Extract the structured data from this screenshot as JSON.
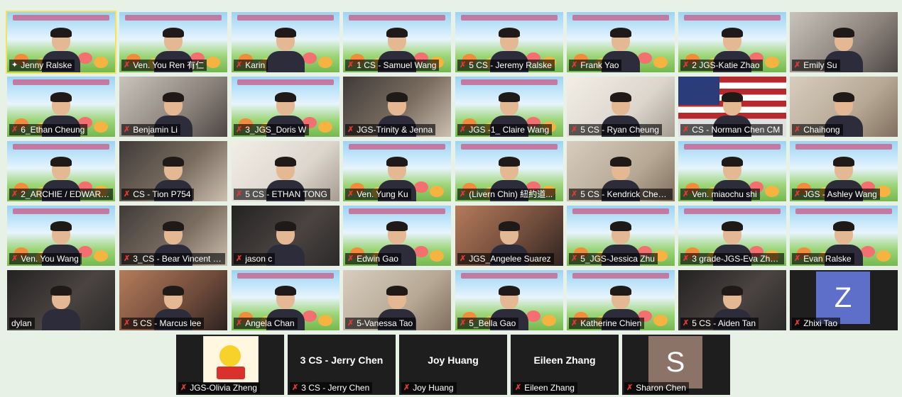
{
  "colors": {
    "active_border": "#f3e35a",
    "muted_mic": "#e53935",
    "avatar_z": "#5d6fc8",
    "avatar_s": "#8b7368"
  },
  "participants": [
    {
      "name": "Jenny Ralske",
      "icon": "pin-icon"
    },
    {
      "name": "Ven. You Ren 有仁",
      "icon": "mic-muted-icon"
    },
    {
      "name": "Karin",
      "icon": "mic-muted-icon"
    },
    {
      "name": "1 CS - Samuel Wang",
      "icon": "mic-muted-icon"
    },
    {
      "name": "5 CS - Jeremy Ralske",
      "icon": "mic-muted-icon"
    },
    {
      "name": "Frank Yao",
      "icon": "mic-muted-icon"
    },
    {
      "name": "2 JGS-Katie Zhao",
      "icon": "mic-muted-icon"
    },
    {
      "name": "Emily Su",
      "icon": "mic-muted-icon"
    },
    {
      "name": "6_Ethan Cheung",
      "icon": "mic-muted-icon"
    },
    {
      "name": "Benjamin Li",
      "icon": "mic-muted-icon"
    },
    {
      "name": "3_JGS_Doris W",
      "icon": "mic-muted-icon"
    },
    {
      "name": "JGS-Trinity & Jenna",
      "icon": "mic-muted-icon"
    },
    {
      "name": "JGS -1_ Claire Wang",
      "icon": "mic-muted-icon"
    },
    {
      "name": "5 CS - Ryan Cheung",
      "icon": "mic-muted-icon"
    },
    {
      "name": "CS - Norman Chen CM",
      "icon": "mic-muted-icon"
    },
    {
      "name": "Chaihong",
      "icon": "mic-muted-icon"
    },
    {
      "name": "2_ARCHIE / EDWARD ...",
      "icon": "mic-muted-icon"
    },
    {
      "name": "CS - Tion P754",
      "icon": "mic-muted-icon"
    },
    {
      "name": "5 CS - ETHAN TONG",
      "icon": "mic-muted-icon"
    },
    {
      "name": "Ven. Yung Ku",
      "icon": "mic-muted-icon"
    },
    {
      "name": "(Livern Chin) 紐約道...",
      "icon": "mic-muted-icon"
    },
    {
      "name": "5 CS - Kendrick Cheu...",
      "icon": "mic-muted-icon"
    },
    {
      "name": "Ven. miaochu shi",
      "icon": "mic-muted-icon"
    },
    {
      "name": "JGS - Ashley Wang",
      "icon": "mic-muted-icon"
    },
    {
      "name": "Ven. You Wang",
      "icon": "mic-muted-icon"
    },
    {
      "name": "3_CS - Bear Vincent H...",
      "icon": "mic-muted-icon"
    },
    {
      "name": "jason c",
      "icon": "mic-muted-icon"
    },
    {
      "name": "Edwin Gao",
      "icon": "mic-muted-icon"
    },
    {
      "name": "JGS_Angelee Suarez",
      "icon": "mic-muted-icon"
    },
    {
      "name": "5_JGS-Jessica Zhu",
      "icon": "mic-muted-icon"
    },
    {
      "name": "3 grade-JGS-Eva Zhe...",
      "icon": "mic-muted-icon"
    },
    {
      "name": "Evan Ralske",
      "icon": "mic-muted-icon"
    },
    {
      "name": "dylan",
      "icon": ""
    },
    {
      "name": "5 CS - Marcus lee",
      "icon": "mic-muted-icon"
    },
    {
      "name": "Angela Chan",
      "icon": "mic-muted-icon"
    },
    {
      "name": "5-Vanessa Tao",
      "icon": "mic-muted-icon"
    },
    {
      "name": "5_Bella Gao",
      "icon": "mic-muted-icon"
    },
    {
      "name": "Katherine Chien",
      "icon": "mic-muted-icon"
    },
    {
      "name": "5 CS - Aiden Tan",
      "icon": "mic-muted-icon"
    },
    {
      "name": "Zhixi Tao",
      "icon": "mic-muted-icon",
      "avatar_letter": "Z"
    }
  ],
  "bottom_row": [
    {
      "name": "JGS-Olivia Zheng",
      "icon": "mic-muted-icon",
      "center": ""
    },
    {
      "name": "3 CS - Jerry Chen",
      "icon": "mic-muted-icon",
      "center": "3 CS - Jerry Chen"
    },
    {
      "name": "Joy Huang",
      "icon": "mic-muted-icon",
      "center": "Joy Huang"
    },
    {
      "name": "Eileen Zhang",
      "icon": "mic-muted-icon",
      "center": "Eileen Zhang"
    },
    {
      "name": "Sharon Chen",
      "icon": "mic-muted-icon",
      "center": "",
      "avatar_letter": "S"
    }
  ]
}
